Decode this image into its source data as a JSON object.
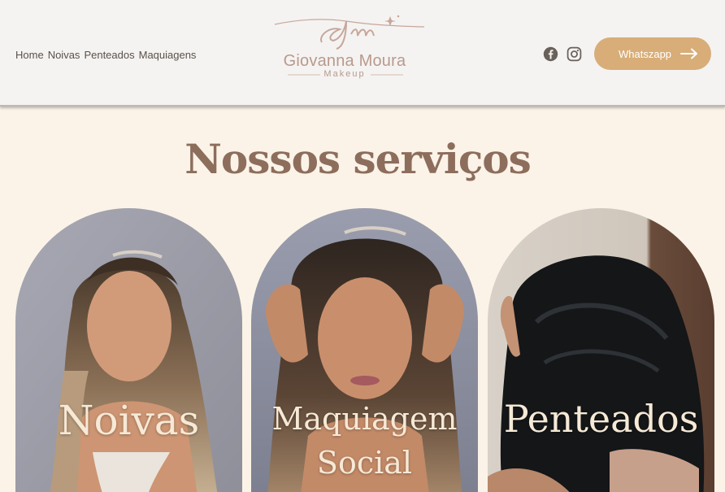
{
  "nav": {
    "items": [
      {
        "label": "Home"
      },
      {
        "label": "Noivas"
      },
      {
        "label": "Penteados"
      },
      {
        "label": "Maquiagens"
      }
    ]
  },
  "logo": {
    "name": "Giovanna Moura",
    "subtitle": "Makeup",
    "accent": "#b9998c"
  },
  "social": {
    "icons": [
      "facebook-icon",
      "instagram-icon"
    ]
  },
  "cta": {
    "label": "Whatszapp",
    "color": "#d8ad78"
  },
  "services": {
    "title": "Nossos serviços",
    "cards": [
      {
        "label": "Noivas"
      },
      {
        "label_line1": "Maquiagem",
        "label_line2": "Social"
      },
      {
        "label": "Penteados"
      }
    ]
  },
  "colors": {
    "header_bg": "#f4f3f2",
    "page_bg": "#fbf3e7",
    "title": "#8d6d5c"
  }
}
